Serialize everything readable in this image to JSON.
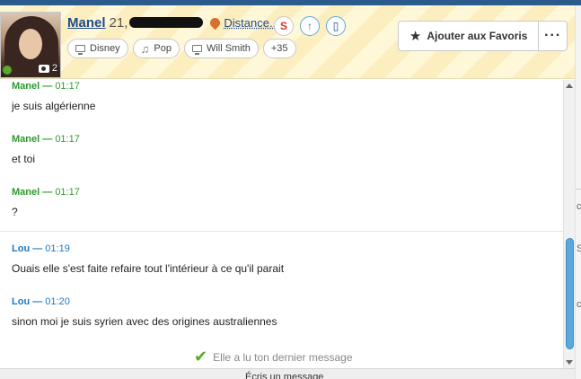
{
  "profile": {
    "name": "Manel",
    "age": "21,",
    "distance_label": "Distance...",
    "photo_count": "2"
  },
  "interests": [
    {
      "label": "Disney",
      "icon": "monitor-icon"
    },
    {
      "label": "Pop",
      "icon": "music-note-icon"
    },
    {
      "label": "Will Smith",
      "icon": "monitor-icon"
    },
    {
      "label": "+35",
      "icon": ""
    }
  ],
  "header_actions": {
    "favorite_label": "Ajouter aux Favoris",
    "more_label": "···",
    "superlike_icon": "s-logo-icon",
    "boost_icon": "up-arrow-icon",
    "mobile_icon": "phone-icon"
  },
  "messages": [
    {
      "author": "Manel",
      "time": "01:17",
      "text": "je suis algérienne"
    },
    {
      "author": "Manel",
      "time": "01:17",
      "text": "et toi"
    },
    {
      "author": "Manel",
      "time": "01:17",
      "text": "?"
    },
    {
      "author": "Lou",
      "time": "01:19",
      "text": "Ouais elle s'est faite refaire tout l'intérieur à ce qu'il parait"
    },
    {
      "author": "Lou",
      "time": "01:20",
      "text": "sinon moi je suis syrien avec des origines australiennes"
    }
  ],
  "read_status": "Elle a lu ton dernier message",
  "composer_placeholder": "Écris un message",
  "colors": {
    "manel": "#2e9a2e",
    "lou": "#1f78c1",
    "accent": "#2a5b8c",
    "scrollbar": "#5aa9dd"
  }
}
